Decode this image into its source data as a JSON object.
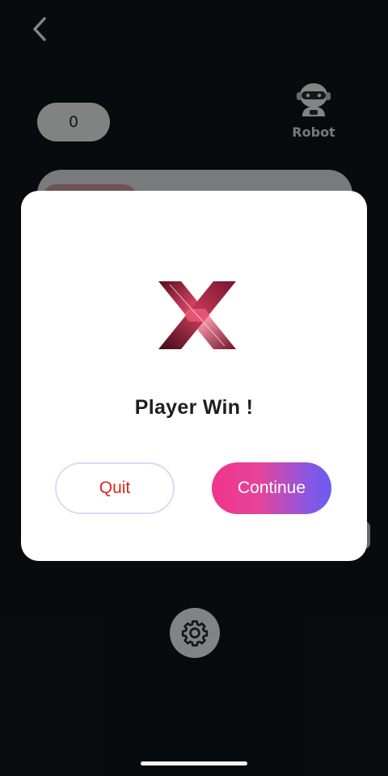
{
  "header": {
    "back_icon": "chevron-left-icon"
  },
  "scoreboard": {
    "player_score": "0",
    "opponent_label": "Robot",
    "opponent_icon": "robot-icon"
  },
  "footer": {
    "settings_icon": "gear-icon"
  },
  "dialog": {
    "winner_symbol": "x-mark-icon",
    "result_text": "Player Win !",
    "quit_label": "Quit",
    "continue_label": "Continue"
  },
  "colors": {
    "background": "#0c1216",
    "quit_text": "#e0261a",
    "continue_gradient_start": "#f0348c",
    "continue_gradient_end": "#6a5cf0"
  }
}
